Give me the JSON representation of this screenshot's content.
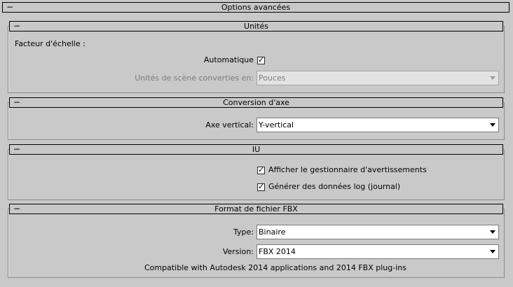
{
  "main_rollout": {
    "collapse": "−",
    "title": "Options avancées"
  },
  "units": {
    "collapse": "−",
    "title": "Unités",
    "scale_factor_label": "Facteur d'échelle :",
    "automatic_label": "Automatique",
    "automatic_checked": true,
    "scene_units_label": "Unités de scène converties en:",
    "scene_units_value": "Pouces"
  },
  "axis": {
    "collapse": "−",
    "title": "Conversion d'axe",
    "up_axis_label": "Axe vertical:",
    "up_axis_value": "Y-vertical"
  },
  "ui": {
    "collapse": "−",
    "title": "IU",
    "show_warnings_label": "Afficher le gestionnaire d'avertissements",
    "show_warnings_checked": true,
    "generate_log_label": "Générer des données log (journal)",
    "generate_log_checked": true
  },
  "fbx": {
    "collapse": "−",
    "title": "Format de fichier FBX",
    "type_label": "Type:",
    "type_value": "Binaire",
    "version_label": "Version:",
    "version_value": "FBX 2014",
    "compat_note": "Compatible with Autodesk 2014 applications and 2014 FBX plug-ins"
  },
  "icons": {
    "checkmark": "✓",
    "dropdown": "chevron-down-icon"
  }
}
